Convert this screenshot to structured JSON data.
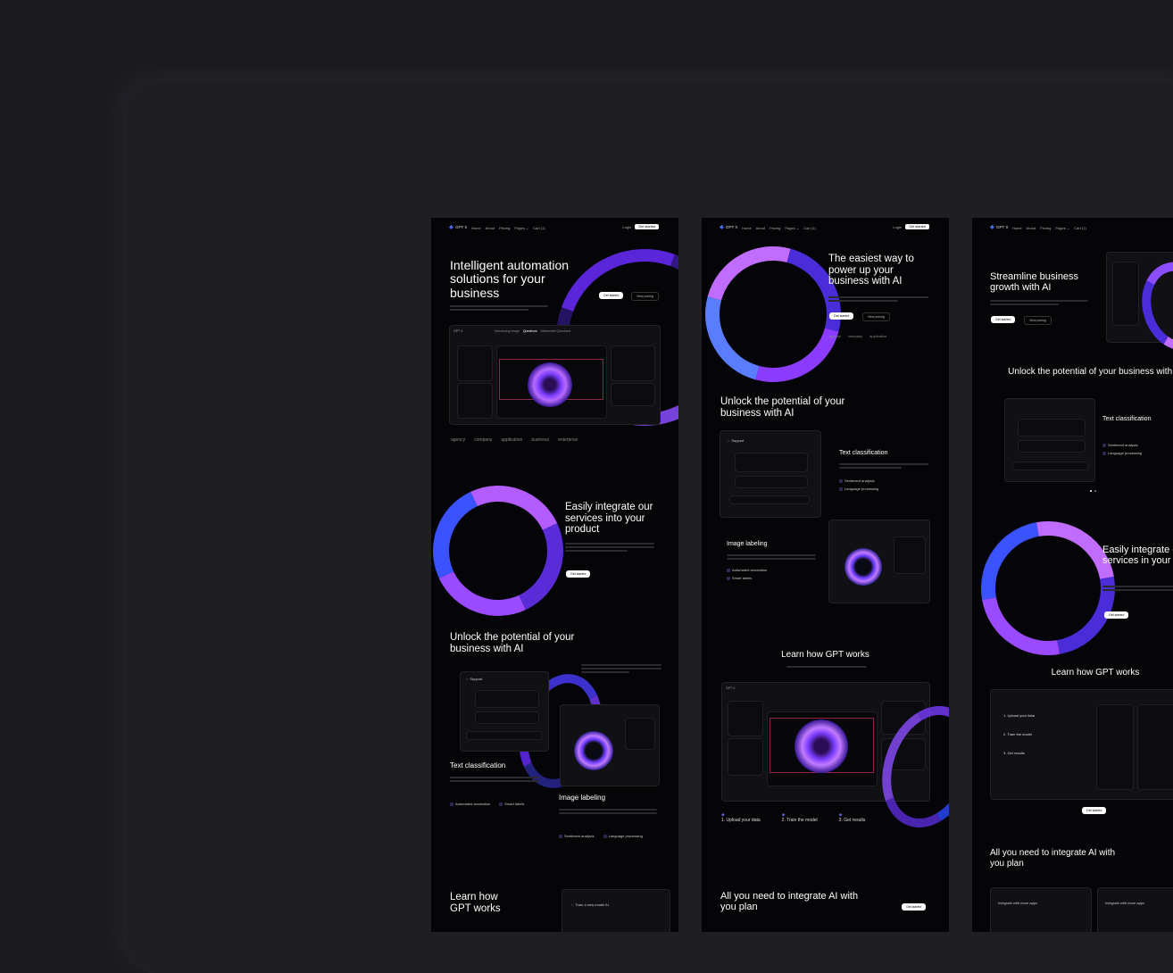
{
  "nav": {
    "logo": "GPT X",
    "items": [
      "Home",
      "About",
      "Pricing",
      "Pages ⌄",
      "Cart (1)"
    ],
    "login": "Login",
    "register": "Get started"
  },
  "page1": {
    "hero_title": "Intelligent automation solutions for your business",
    "hero_btn1": "Get started",
    "hero_btn2": "View pricing",
    "app_tab1": "Introducing image",
    "app_tab1b": "Questions",
    "app_tab2": "Multimodel Questions",
    "brands": [
      "agency",
      "company",
      "application",
      "business",
      "enterprise"
    ],
    "integrate_title": "Easily integrate our services into your product",
    "integrate_btn": "Get started",
    "unlock_title": "Unlock the potential of your business with AI",
    "support_label": "Support",
    "text_classification": "Text classification",
    "image_labeling": "Image labeling",
    "feat1": "Automated annotation",
    "feat2": "Smart labels",
    "feat3": "Sentiment analysis",
    "feat4": "Language processing",
    "learn_title": "Learn how GPT works",
    "train_label": "Train a new model AI"
  },
  "page2": {
    "hero_title": "The easiest way to power up your business with AI",
    "hero_btn1": "Get started",
    "hero_btn2": "View pricing",
    "brands": [
      "agency",
      "company",
      "application"
    ],
    "unlock_title": "Unlock the potential of your business with AI",
    "support_label": "Support",
    "text_classification": "Text classification",
    "feat_a": "Sentiment analysis",
    "feat_b": "Language processing",
    "image_labeling": "Image labeling",
    "feat_c": "Automated annotation",
    "feat_d": "Smart labels",
    "learn_title": "Learn how GPT works",
    "step1": "1. Upload your data",
    "step2": "2. Train the model",
    "step3": "3. Get results",
    "plan_title": "All you need to integrate AI with you plan",
    "plan_btn": "Get started"
  },
  "page3": {
    "hero_title": "Streamline business growth with AI",
    "hero_btn1": "Get started",
    "hero_btn2": "View pricing",
    "unlock_title": "Unlock the potential of your business with AI",
    "text_classification": "Text classification",
    "feat_a": "Sentiment analysis",
    "feat_b": "Language processing",
    "integrate_title": "Easily integrate our services in your product",
    "integrate_btn": "Get started",
    "learn_title": "Learn how GPT works",
    "step1": "1. Upload your data",
    "step2": "2. Train the model",
    "step3": "3. Get results",
    "contact_btn": "Get started",
    "plan_title": "All you need to integrate AI with you plan",
    "card1": "Integrate with more apps",
    "card2": "Integrate with more apps"
  },
  "colors": {
    "background": "#1b1b1d",
    "frame": "#1f1f21",
    "page": "#050507",
    "accent_purple": "#8a3cff",
    "accent_blue": "#3c5cff"
  }
}
